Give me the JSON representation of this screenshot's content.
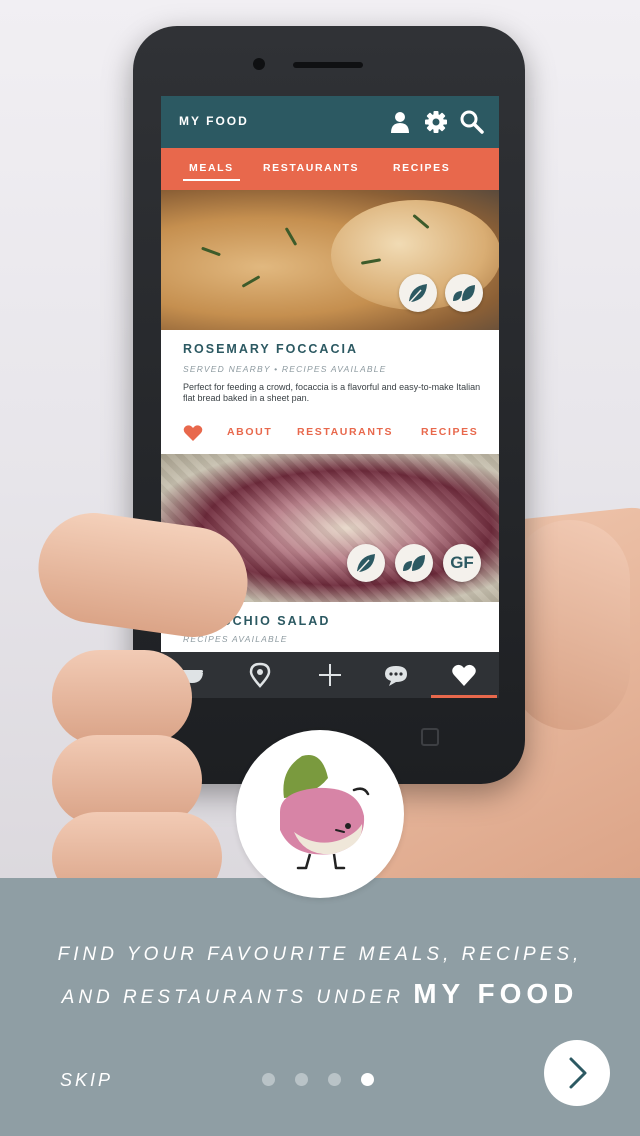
{
  "app": {
    "title": "MY FOOD",
    "tabs": [
      {
        "label": "MEALS",
        "active": true
      },
      {
        "label": "RESTAURANTS",
        "active": false
      },
      {
        "label": "RECIPES",
        "active": false
      }
    ],
    "icons": [
      "user-icon",
      "gear-icon",
      "search-icon"
    ]
  },
  "cards": [
    {
      "title": "ROSEMARY FOCCACIA",
      "subtitle": "SERVED NEARBY • RECIPES AVAILABLE",
      "description": "Perfect for feeding a crowd, focaccia is a flavorful and easy-to-make Italian flat bread baked in a sheet pan.",
      "badges": [
        "leaf-icon",
        "vegan-leaves-icon"
      ],
      "actions": [
        "ABOUT",
        "RESTAURANTS",
        "RECIPES"
      ]
    },
    {
      "title": "RADICCHIO SALAD",
      "subtitle": "RECIPES AVAILABLE",
      "badges": [
        "leaf-icon",
        "vegan-leaves-icon",
        "GF"
      ]
    }
  ],
  "bottom_nav": [
    "bowl-icon",
    "location-pin-icon",
    "plus-icon",
    "chat-icon",
    "heart-icon"
  ],
  "onboarding": {
    "message_line1": "FIND YOUR FAVOURITE MEALS, RECIPES,",
    "message_line2": "AND RESTAURANTS UNDER",
    "message_strong": "MY FOOD",
    "skip_label": "SKIP",
    "page_count": 4,
    "current_page": 4
  },
  "colors": {
    "app_bar": "#2c5962",
    "accent": "#e8684c",
    "panel": "#8f9ea4",
    "bottom_nav": "#2f3236"
  }
}
